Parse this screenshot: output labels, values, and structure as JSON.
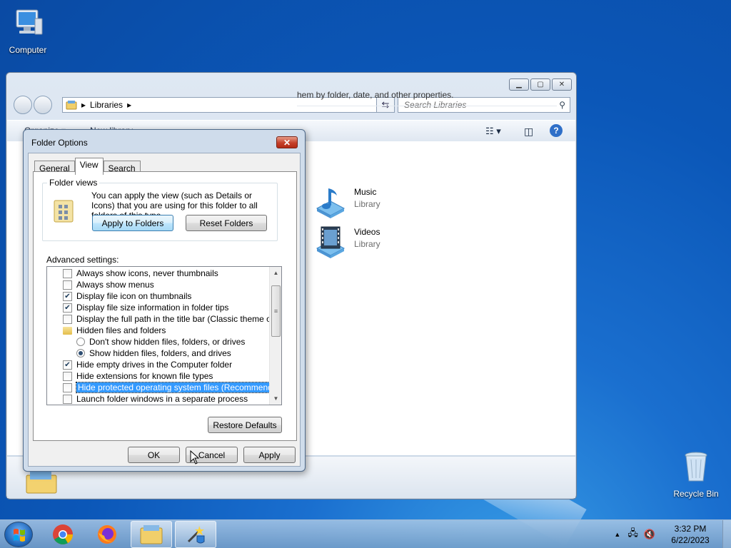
{
  "desktop": {
    "icons": [
      {
        "label": "Computer"
      },
      {
        "label": "Recycle Bin"
      }
    ]
  },
  "explorer": {
    "address": {
      "crumb": "Libraries"
    },
    "search": {
      "placeholder": "Search Libraries"
    },
    "toolbar": {
      "organize": "Organize ▾",
      "new_library": "New library"
    },
    "hint": "hem by folder, date, and other properties.",
    "libraries": [
      {
        "name": "Music",
        "type": "Library"
      },
      {
        "name": "Videos",
        "type": "Library"
      }
    ]
  },
  "dialog": {
    "title": "Folder Options",
    "close": "✕",
    "tabs": [
      "General",
      "View",
      "Search"
    ],
    "folder_views": {
      "legend": "Folder views",
      "description": "You can apply the view (such as Details or Icons) that you are using for this folder to all folders of this type.",
      "apply_button": "Apply to Folders",
      "reset_button": "Reset Folders"
    },
    "advanced_label": "Advanced settings:",
    "advanced": [
      {
        "kind": "checkbox",
        "label": "Always show icons, never thumbnails",
        "checked": false,
        "indent": 0
      },
      {
        "kind": "checkbox",
        "label": "Always show menus",
        "checked": false,
        "indent": 0
      },
      {
        "kind": "checkbox",
        "label": "Display file icon on thumbnails",
        "checked": true,
        "indent": 0
      },
      {
        "kind": "checkbox",
        "label": "Display file size information in folder tips",
        "checked": true,
        "indent": 0
      },
      {
        "kind": "checkbox",
        "label": "Display the full path in the title bar (Classic theme only)",
        "checked": false,
        "indent": 0
      },
      {
        "kind": "folder",
        "label": "Hidden files and folders",
        "indent": 0
      },
      {
        "kind": "radio",
        "label": "Don't show hidden files, folders, or drives",
        "checked": false,
        "indent": 1
      },
      {
        "kind": "radio",
        "label": "Show hidden files, folders, and drives",
        "checked": true,
        "indent": 1
      },
      {
        "kind": "checkbox",
        "label": "Hide empty drives in the Computer folder",
        "checked": true,
        "indent": 0
      },
      {
        "kind": "checkbox",
        "label": "Hide extensions for known file types",
        "checked": false,
        "indent": 0
      },
      {
        "kind": "checkbox",
        "label": "Hide protected operating system files (Recommended)",
        "checked": false,
        "indent": 0,
        "selected": true
      },
      {
        "kind": "checkbox",
        "label": "Launch folder windows in a separate process",
        "checked": false,
        "indent": 0
      }
    ],
    "restore_button": "Restore Defaults",
    "ok_button": "OK",
    "cancel_button": "Cancel",
    "apply_button": "Apply"
  },
  "taskbar": {
    "apps": [
      "start",
      "chrome",
      "firefox",
      "explorer",
      "program"
    ],
    "clock": {
      "time": "3:32 PM",
      "date": "6/22/2023"
    }
  }
}
